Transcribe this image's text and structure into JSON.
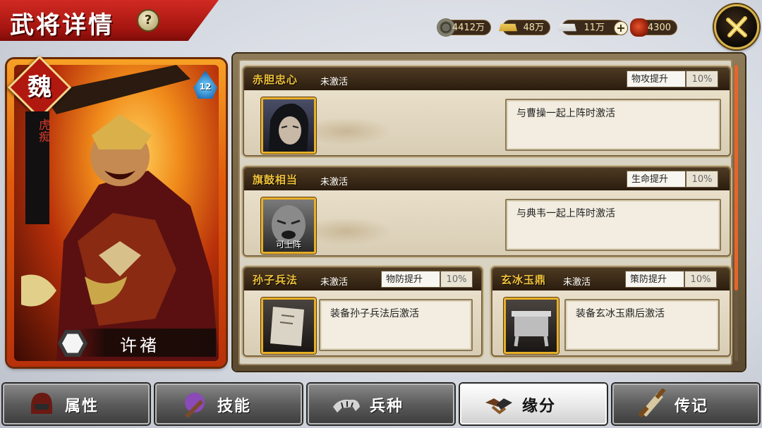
{
  "header": {
    "title": "武将详情",
    "help_symbol": "?"
  },
  "resources": [
    {
      "icon": "copper-coin-icon",
      "value": "4412万"
    },
    {
      "icon": "gold-ingot-icon",
      "value": "48万"
    },
    {
      "icon": "silver-ingot-icon",
      "value": "11万"
    },
    {
      "icon": "meat-food-icon",
      "value": "4300"
    }
  ],
  "add_resource_symbol": "+",
  "hero": {
    "kingdom": "魏",
    "title": "虎痴",
    "level": "12",
    "name": "许褚"
  },
  "bonds": [
    {
      "name": "赤胆忠心",
      "status": "未激活",
      "attribute": "物攻提升",
      "percent": "10%",
      "portrait_caption": "",
      "condition": "与曹操一起上阵时激活"
    },
    {
      "name": "旗鼓相当",
      "status": "未激活",
      "attribute": "生命提升",
      "percent": "10%",
      "portrait_caption": "可上阵",
      "condition": "与典韦一起上阵时激活"
    },
    {
      "name": "孙子兵法",
      "status": "未激活",
      "attribute": "物防提升",
      "percent": "10%",
      "portrait_caption": "",
      "condition": "装备孙子兵法后激活"
    },
    {
      "name": "玄冰玉鼎",
      "status": "未激活",
      "attribute": "策防提升",
      "percent": "10%",
      "portrait_caption": "",
      "condition": "装备玄冰玉鼎后激活"
    }
  ],
  "tabs": [
    {
      "label": "属性",
      "active": false
    },
    {
      "label": "技能",
      "active": false
    },
    {
      "label": "兵种",
      "active": false
    },
    {
      "label": "缘分",
      "active": true
    },
    {
      "label": "传记",
      "active": false
    }
  ],
  "colors": {
    "accent_red": "#b11810",
    "gold_text": "#f0c23a",
    "active_tab": "#ffffff"
  }
}
